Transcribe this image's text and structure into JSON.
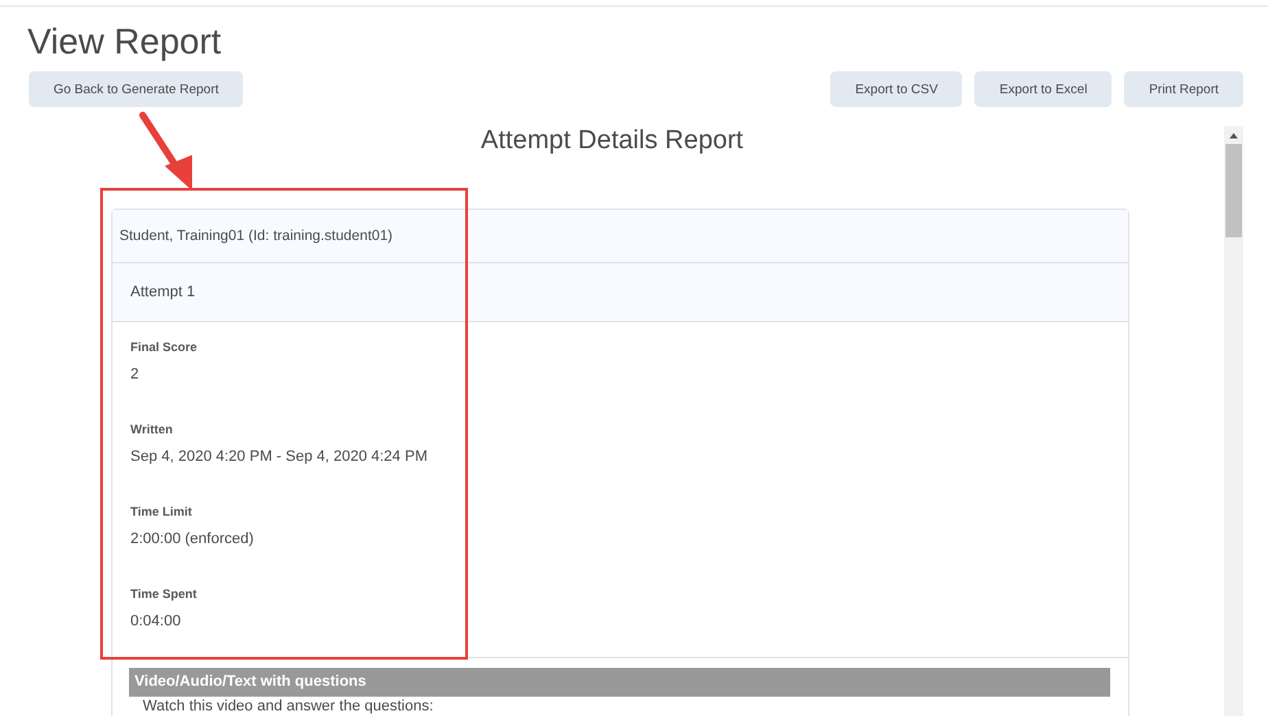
{
  "page": {
    "title": "View Report"
  },
  "toolbar": {
    "back_button": "Go Back to Generate Report",
    "actions": [
      "Export to CSV",
      "Export to Excel",
      "Print Report"
    ]
  },
  "report": {
    "title": "Attempt Details Report",
    "student": "Student, Training01 (Id: training.student01)",
    "attempt": "Attempt 1",
    "details": [
      {
        "label": "Final Score",
        "value": "2"
      },
      {
        "label": "Written",
        "value": "Sep 4, 2020 4:20 PM - Sep 4, 2020 4:24 PM"
      },
      {
        "label": "Time Limit",
        "value": "2:00:00 (enforced)"
      },
      {
        "label": "Time Spent",
        "value": "0:04:00"
      }
    ],
    "section": {
      "title": "Video/Audio/Text with questions",
      "text": "Watch this video and answer the questions:"
    }
  }
}
